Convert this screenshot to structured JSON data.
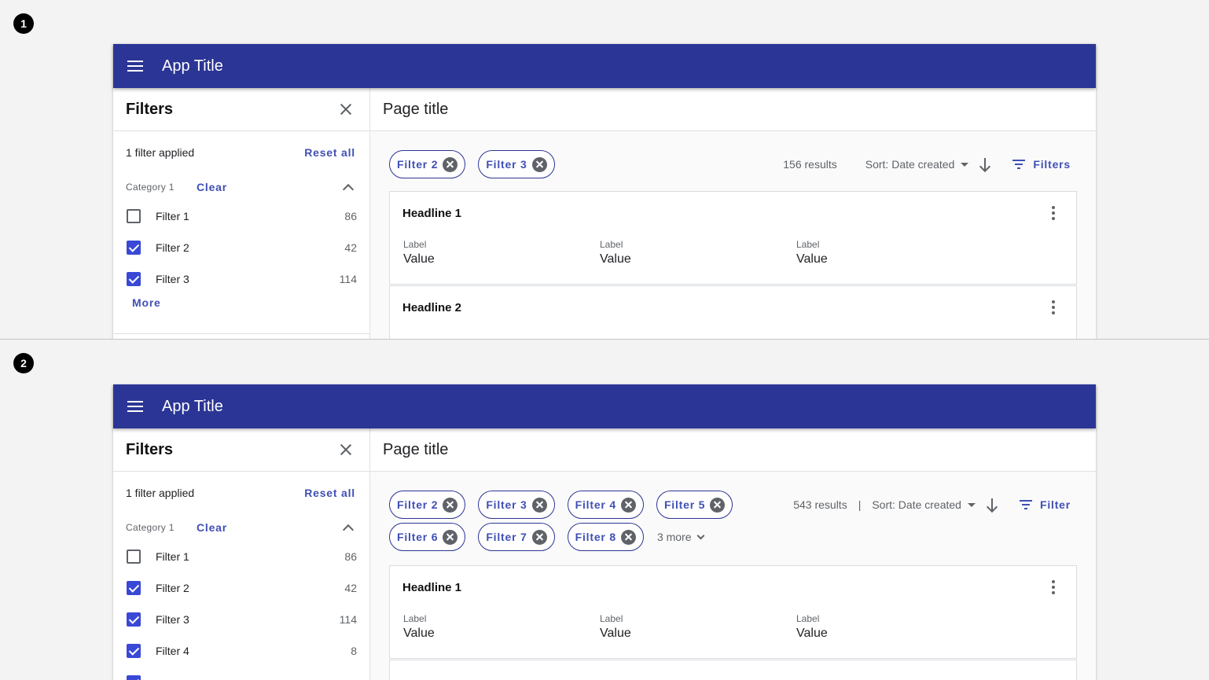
{
  "panels": [
    {
      "marker": "1",
      "app_title": "App Title",
      "sidebar": {
        "title": "Filters",
        "applied": "1 filter applied",
        "reset": "Reset all",
        "category": "Category 1",
        "clear": "Clear",
        "items": [
          {
            "label": "Filter 1",
            "count": "86",
            "checked": false
          },
          {
            "label": "Filter 2",
            "count": "42",
            "checked": true
          },
          {
            "label": "Filter 3",
            "count": "114",
            "checked": true
          }
        ],
        "more": "More"
      },
      "main": {
        "page_title": "Page title",
        "chips": [
          "Filter 2",
          "Filter 3"
        ],
        "results": "156 results",
        "sort": "Sort: Date created",
        "filter_button": "Filters",
        "cards": [
          {
            "headline": "Headline 1",
            "fields": [
              {
                "label": "Label",
                "value": "Value"
              },
              {
                "label": "Label",
                "value": "Value"
              },
              {
                "label": "Label",
                "value": "Value"
              }
            ]
          },
          {
            "headline": "Headline 2",
            "fields": []
          }
        ]
      }
    },
    {
      "marker": "2",
      "app_title": "App Title",
      "sidebar": {
        "title": "Filters",
        "applied": "1 filter applied",
        "reset": "Reset all",
        "category": "Category 1",
        "clear": "Clear",
        "items": [
          {
            "label": "Filter 1",
            "count": "86",
            "checked": false
          },
          {
            "label": "Filter 2",
            "count": "42",
            "checked": true
          },
          {
            "label": "Filter 3",
            "count": "114",
            "checked": true
          },
          {
            "label": "Filter 4",
            "count": "8",
            "checked": true
          }
        ]
      },
      "main": {
        "page_title": "Page title",
        "chips": [
          "Filter 2",
          "Filter 3",
          "Filter 4",
          "Filter 5",
          "Filter 6",
          "Filter 7",
          "Filter 8"
        ],
        "more_chips": "3 more",
        "results": "543 results",
        "separator": "|",
        "sort": "Sort: Date created",
        "filter_button": "Filter",
        "cards": [
          {
            "headline": "Headline 1",
            "fields": [
              {
                "label": "Label",
                "value": "Value"
              },
              {
                "label": "Label",
                "value": "Value"
              },
              {
                "label": "Label",
                "value": "Value"
              }
            ]
          }
        ]
      }
    }
  ],
  "colors": {
    "app_bar": "#2b3595",
    "accent": "#3f4fb5",
    "checkbox": "#3949d6",
    "chip_close": "#5f6368"
  },
  "icons": [
    "menu-icon",
    "close-icon",
    "chevron-up-icon",
    "checkbox-icon",
    "chip-close-icon",
    "dropdown-caret-icon",
    "arrow-down-icon",
    "filter-list-icon",
    "more-vert-icon",
    "chevron-down-icon"
  ]
}
